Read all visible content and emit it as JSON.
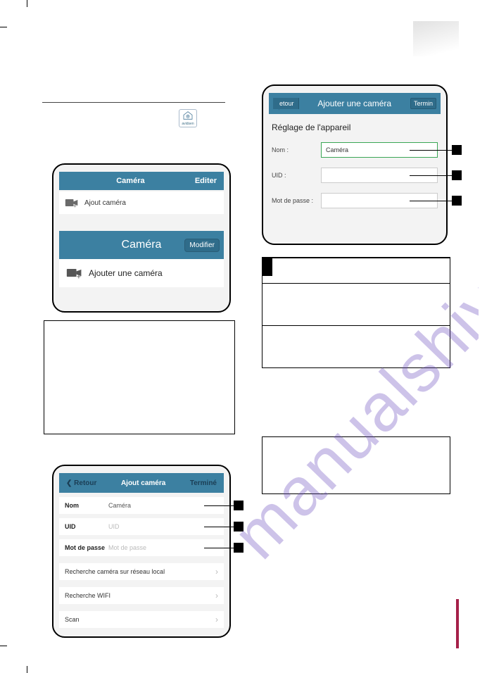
{
  "colors": {
    "primary": "#3c80a1",
    "accent_dark": "#2f6c8a",
    "green_border": "#3aa655",
    "tag": "#000000",
    "brand": "#a52049",
    "watermark": "#6a4bbf"
  },
  "app_icon": {
    "label": "avidsen"
  },
  "frame1": {
    "header1_center": "Caméra",
    "header1_right": "Editer",
    "item1": "Ajout caméra",
    "header2_center": "Caméra",
    "header2_btn": "Modifier",
    "item2": "Ajouter une caméra"
  },
  "frame2": {
    "back": "Retour",
    "title": "Ajout caméra",
    "done": "Terminé",
    "rows": [
      {
        "label": "Nom",
        "value": "Caméra",
        "placeholder": false
      },
      {
        "label": "UID",
        "value": "UID",
        "placeholder": true
      },
      {
        "label": "Mot de passe",
        "value": "Mot de passe",
        "placeholder": true
      }
    ],
    "nav": [
      "Recherche caméra sur réseau local",
      "Recherche WIFI",
      "Scan"
    ]
  },
  "frame3": {
    "back": "retour",
    "title": "Ajouter une caméra",
    "done": "Termin",
    "section": "Réglage de l'appareil",
    "rows": [
      {
        "label": "Nom :",
        "value": "Caméra",
        "green": true
      },
      {
        "label": "UID :",
        "value": "",
        "green": false
      },
      {
        "label": "Mot de passe :",
        "value": "",
        "green": false
      }
    ]
  },
  "watermark": "manualshive.com"
}
